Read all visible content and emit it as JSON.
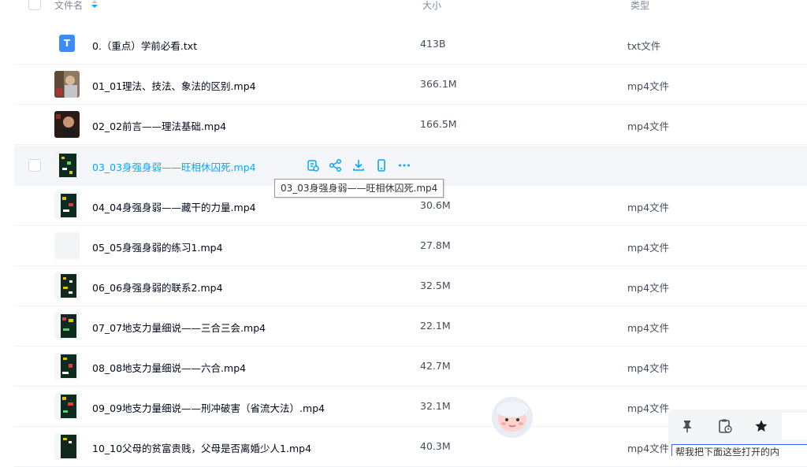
{
  "header": {
    "name_label": "文件名",
    "size_label": "大小",
    "type_label": "类型"
  },
  "files": [
    {
      "name": "0.（重点）学前必看.txt",
      "size": "413B",
      "type": "txt文件",
      "icon": "txt-file-icon"
    },
    {
      "name": "01_01理法、技法、象法的区别.mp4",
      "size": "366.1M",
      "type": "mp4文件",
      "icon": "video-thumbnail"
    },
    {
      "name": "02_02前言——理法基础.mp4",
      "size": "166.5M",
      "type": "mp4文件",
      "icon": "video-thumbnail"
    },
    {
      "name": "03_03身强身弱——旺相休囚死.mp4",
      "size": "",
      "type": "",
      "icon": "video-thumbnail"
    },
    {
      "name": "04_04身强身弱——藏干的力量.mp4",
      "size": "30.6M",
      "type": "mp4文件",
      "icon": "video-thumbnail"
    },
    {
      "name": "05_05身强身弱的练习1.mp4",
      "size": "27.8M",
      "type": "mp4文件",
      "icon": "video-thumbnail"
    },
    {
      "name": "06_06身强身弱的联系2.mp4",
      "size": "32.5M",
      "type": "mp4文件",
      "icon": "video-thumbnail"
    },
    {
      "name": "07_07地支力量细说——三合三会.mp4",
      "size": "22.1M",
      "type": "mp4文件",
      "icon": "video-thumbnail"
    },
    {
      "name": "08_08地支力量细说——六合.mp4",
      "size": "42.7M",
      "type": "mp4文件",
      "icon": "video-thumbnail"
    },
    {
      "name": "09_09地支力量细说——刑冲破害（省流大法）.mp4",
      "size": "32.1M",
      "type": "mp4文件",
      "icon": "video-thumbnail"
    },
    {
      "name": "10_10父母的贫富贵贱，父母是否离婚少人1.mp4",
      "size": "40.3M",
      "type": "mp4文件",
      "icon": "video-thumbnail"
    }
  ],
  "hover_actions": [
    "save-to-drive-icon",
    "share-icon",
    "download-icon",
    "send-to-phone-icon",
    "more-icon"
  ],
  "tooltip": "03_03身强身弱——旺相休囚死.mp4",
  "dock": {
    "buttons": [
      "pin-icon",
      "clipboard-history-icon",
      "star-icon"
    ],
    "text": "帮我把下面这些打开的内"
  },
  "colors": {
    "accent": "#06a7ff",
    "text": "#03081a",
    "muted": "#818999"
  }
}
